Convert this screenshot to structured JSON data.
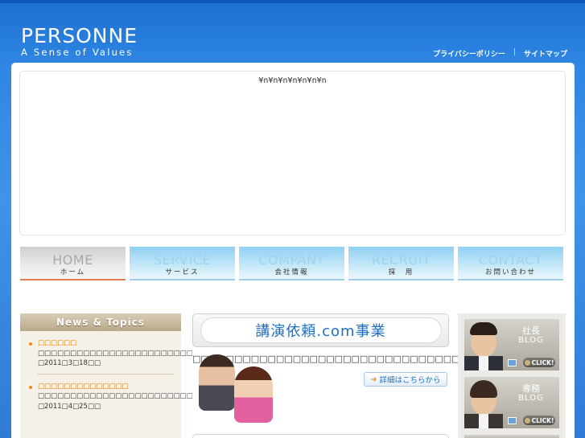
{
  "header": {
    "logo_name": "PERSONNE",
    "logo_tagline": "A Sense of Values",
    "links": [
      {
        "label": "プライバシーポリシー"
      },
      {
        "label": "サイトマップ"
      }
    ],
    "separator": "|"
  },
  "flash": {
    "escaped_text": "¥n¥n¥n¥n¥n¥n¥n"
  },
  "nav": [
    {
      "en": "HOME",
      "jp": "ホーム"
    },
    {
      "en": "SERVICE",
      "jp": "サービス"
    },
    {
      "en": "COMPANY",
      "jp": "会社情報"
    },
    {
      "en": "RECRUIT",
      "jp": "採　用"
    },
    {
      "en": "CONTACT",
      "jp": "お問い合わせ"
    }
  ],
  "news": {
    "heading": "News & Topics",
    "items": [
      {
        "title": "□□□□□□",
        "body_pre": "□□□□□□□□□□□□□□□□□□□□□□□□□□□□□□□□□□□.com□□□□□□□□□□",
        "body_hl": "□□□",
        "body_post": "□□□□□□□□",
        "date": "□2011□3□18□□"
      },
      {
        "title": "□□□□□□□□□□□□□□",
        "body_pre": "□□□□□□□□□□□□□□□□□□□□□□□□□□□□□□□□",
        "body_hl": "□□□",
        "body_post": "□□□□□□□□□",
        "date": "□2011□4□25□□"
      }
    ]
  },
  "kouen": {
    "banner_title": "講演依頼.com事業",
    "description": "□□□□□□□□□□□□□□□□□□□□□□□□□□□□□□□□",
    "more_label": "詳細はこちらから"
  },
  "blogs": [
    {
      "role": "社長",
      "word": "BLOG",
      "click": "CLICK!"
    },
    {
      "role": "専務",
      "word": "BLOG",
      "click": "CLICK!"
    }
  ],
  "colors": {
    "brand_blue": "#1b6fd0",
    "home_accent": "#e67a55",
    "news_accent": "#e67a00",
    "link_blue": "#0a6fc9"
  }
}
